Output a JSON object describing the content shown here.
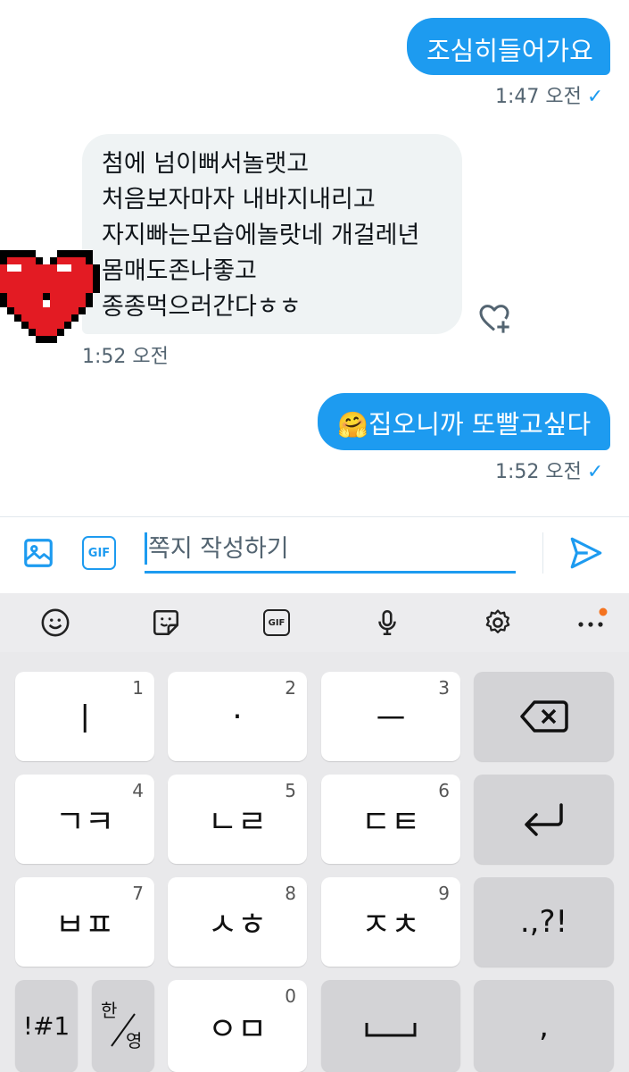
{
  "messages": {
    "m1": {
      "text": "조심히들어가요",
      "time": "1:47 오전",
      "status": "✓"
    },
    "m2": {
      "lines": [
        "첨에 넘이뻐서놀랫고",
        "처음보자마자 내바지내리고",
        "자지빠는모습에놀랏네 개걸레년",
        "몸매도존나좋고",
        "종종먹으러간다ㅎㅎ"
      ],
      "time": "1:52 오전"
    },
    "m3": {
      "emoji": "🤗",
      "text": "집오니까 또빨고싶다",
      "time": "1:52 오전",
      "status": "✓"
    }
  },
  "composer": {
    "placeholder": "쪽지 작성하기",
    "gif_label": "GIF"
  },
  "keyboard": {
    "toolbar": {
      "gif_label": "GIF"
    },
    "keys": [
      {
        "label": "ㅣ",
        "num": "1"
      },
      {
        "label": "·",
        "num": "2"
      },
      {
        "label": "ㅡ",
        "num": "3"
      },
      {
        "label": "ㄱㅋ",
        "num": "4"
      },
      {
        "label": "ㄴㄹ",
        "num": "5"
      },
      {
        "label": "ㄷㅌ",
        "num": "6"
      },
      {
        "label": "ㅂㅍ",
        "num": "7"
      },
      {
        "label": "ㅅㅎ",
        "num": "8"
      },
      {
        "label": "ㅈㅊ",
        "num": "9"
      },
      {
        "label": "ㅇㅁ",
        "num": "0"
      }
    ],
    "punct": ".,?!",
    "symbols": "!#1",
    "lang_top": "한",
    "lang_bottom": "영",
    "comma": ","
  },
  "colors": {
    "accent": "#1d9bf0",
    "notification_dot": "#f4731f"
  }
}
